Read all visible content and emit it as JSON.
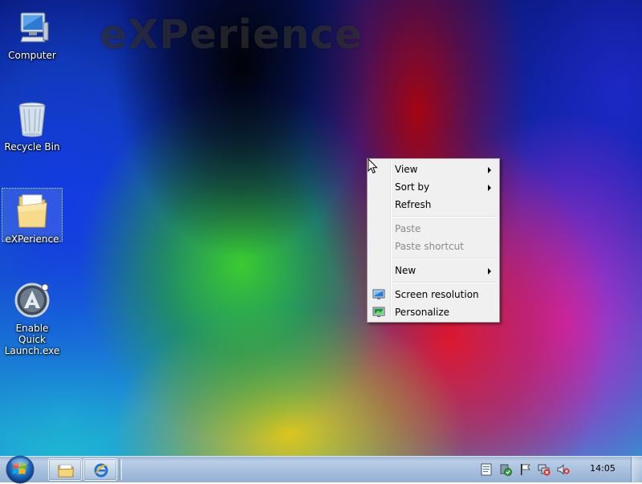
{
  "wallpaper": {
    "logo_text": "eXPerience"
  },
  "desktop_icons": [
    {
      "label": "Computer",
      "icon": "computer-icon"
    },
    {
      "label": "Recycle Bin",
      "icon": "recycle-bin-icon"
    },
    {
      "label": "eXPerience",
      "icon": "folder-icon",
      "selected": true
    },
    {
      "label": "Enable Quick Launch.exe",
      "icon": "quick-launch-app-icon"
    }
  ],
  "context_menu": {
    "items": [
      {
        "label": "View",
        "submenu": true,
        "enabled": true
      },
      {
        "label": "Sort by",
        "submenu": true,
        "enabled": true
      },
      {
        "label": "Refresh",
        "submenu": false,
        "enabled": true
      },
      {
        "label": "Paste",
        "submenu": false,
        "enabled": false
      },
      {
        "label": "Paste shortcut",
        "submenu": false,
        "enabled": false
      },
      {
        "label": "New",
        "submenu": true,
        "enabled": true
      },
      {
        "label": "Screen resolution",
        "submenu": false,
        "enabled": true,
        "icon": "screen-resolution-icon"
      },
      {
        "label": "Personalize",
        "submenu": false,
        "enabled": true,
        "icon": "personalize-icon"
      }
    ]
  },
  "taskbar": {
    "start_button": "windows-orb-icon",
    "pinned": [
      "windows-explorer-icon",
      "internet-explorer-icon"
    ],
    "tray_icons": [
      "notes-icon",
      "security-check-icon",
      "action-center-flag-icon",
      "network-error-icon",
      "volume-muted-icon"
    ],
    "clock": "14:05"
  },
  "colors": {
    "menu_bg": "#f0f0f0",
    "menu_border": "#979797",
    "taskbar": "#a9c1de",
    "disabled_text": "#8a8a8a"
  }
}
